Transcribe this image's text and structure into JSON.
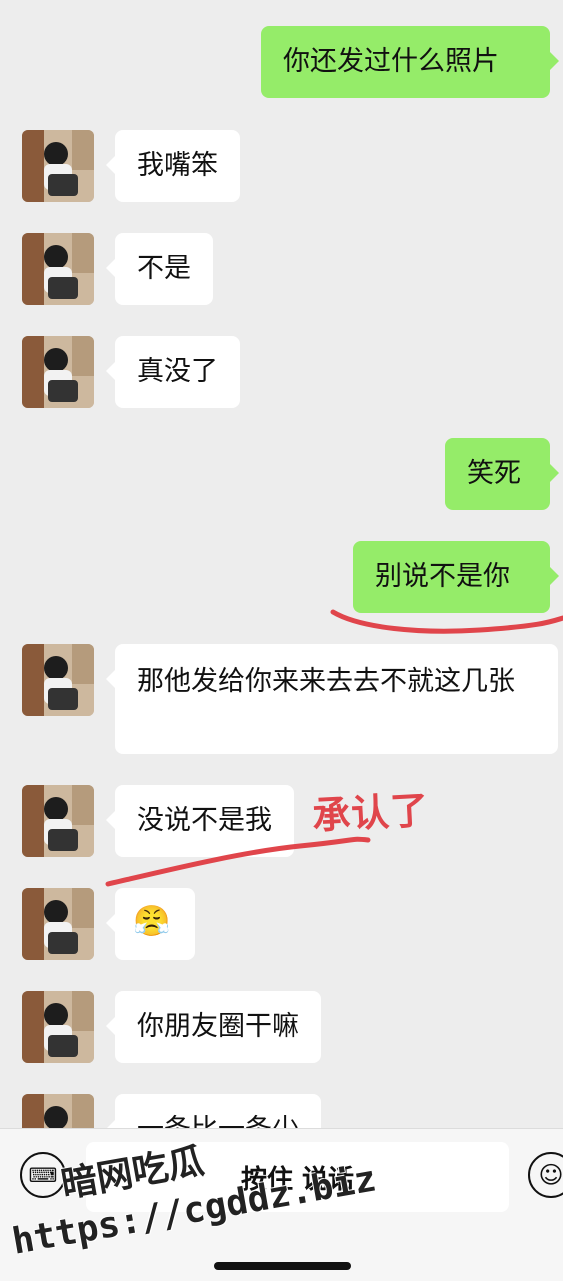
{
  "messages": [
    {
      "side": "out",
      "text": "你还发过什么照片"
    },
    {
      "side": "in",
      "text": "我嘴笨"
    },
    {
      "side": "in",
      "text": "不是"
    },
    {
      "side": "in",
      "text": "真没了"
    },
    {
      "side": "out",
      "text": "笑死"
    },
    {
      "side": "out",
      "text": "别说不是你"
    },
    {
      "side": "in",
      "text": "那他发给你来来去去不就这几张"
    },
    {
      "side": "in",
      "text": "没说不是我"
    },
    {
      "side": "in",
      "text": "😤"
    },
    {
      "side": "in",
      "text": "你朋友圈干嘛"
    },
    {
      "side": "in",
      "text": "一条比一条少"
    }
  ],
  "annotation": {
    "text": "承认了",
    "color": "#e0454b"
  },
  "input_bar": {
    "voice_label": "按住 说话",
    "keyboard_icon": "keyboard-icon",
    "emoji_icon": "emoji-icon"
  },
  "watermark": {
    "line1": "暗网吃瓜",
    "line2": "https://cgddz.biz"
  },
  "colors": {
    "outgoing": "#95ec69",
    "incoming": "#ffffff",
    "background": "#ededed",
    "annotation": "#e0454b"
  }
}
